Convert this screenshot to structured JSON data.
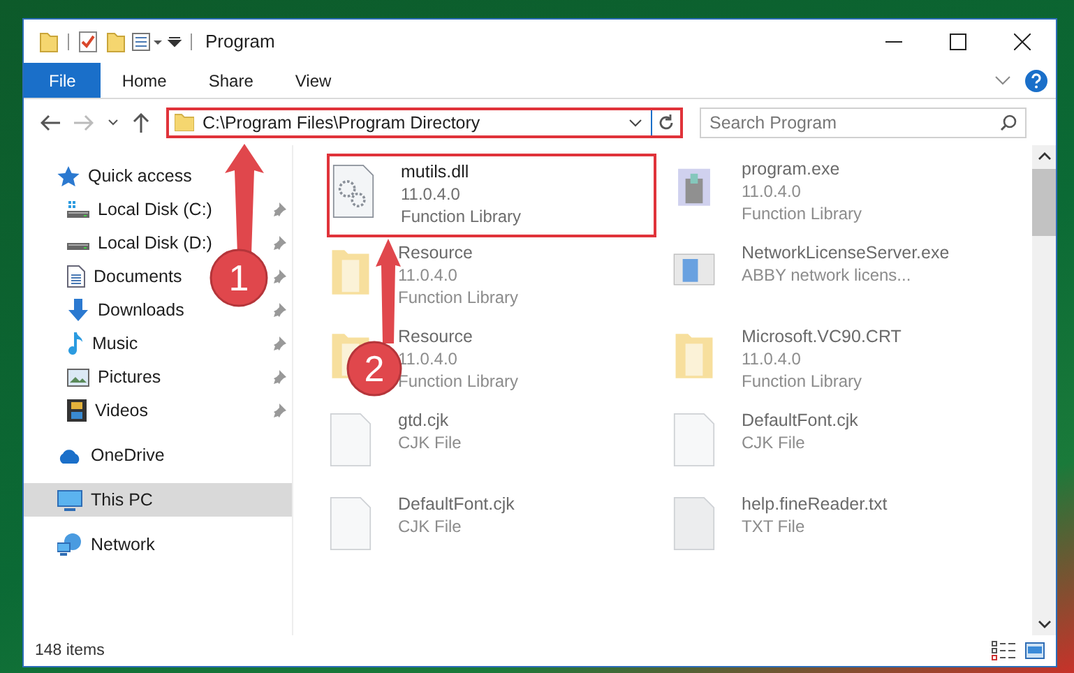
{
  "window": {
    "title": "Program"
  },
  "ribbon_tabs": [
    {
      "label": "File",
      "selected": true
    },
    {
      "label": "Home",
      "selected": false
    },
    {
      "label": "Share",
      "selected": false
    },
    {
      "label": "View",
      "selected": false
    }
  ],
  "address": {
    "value": "C:\\Program Files\\Program Directory",
    "highlighted": true
  },
  "search": {
    "placeholder": "Search Program"
  },
  "sidebar": [
    {
      "label": "Quick access",
      "kind": "star",
      "selected": false,
      "children": [
        {
          "label": "Local Disk (C:)",
          "kind": "drivec",
          "pinned": true
        },
        {
          "label": "Local Disk (D:)",
          "kind": "drive",
          "pinned": true
        },
        {
          "label": "Documents",
          "kind": "document",
          "pinned": true
        },
        {
          "label": "Downloads",
          "kind": "download",
          "pinned": true
        },
        {
          "label": "Music",
          "kind": "music",
          "pinned": true
        },
        {
          "label": "Pictures",
          "kind": "pictures",
          "pinned": true
        },
        {
          "label": "Videos",
          "kind": "videos",
          "pinned": true
        }
      ]
    },
    {
      "label": "OneDrive",
      "kind": "cloud",
      "selected": false
    },
    {
      "label": "This PC",
      "kind": "computer",
      "selected": true
    },
    {
      "label": "Network",
      "kind": "network",
      "selected": false
    }
  ],
  "files": [
    {
      "name": "mutils.dll",
      "version": "11.0.4.0",
      "type": "Function Library",
      "kind": "dll",
      "blurred": false,
      "highlighted": true
    },
    {
      "name": "program.exe",
      "version": "11.0.4.0",
      "type": "Function Library",
      "kind": "exe",
      "blurred": true,
      "highlighted": false
    },
    {
      "name": "Resource",
      "version": "11.0.4.0",
      "type": "Function Library",
      "kind": "folder",
      "blurred": true,
      "highlighted": false
    },
    {
      "name": "NetworkLicenseServer.exe",
      "type": "ABBY network licens...",
      "kind": "app",
      "blurred": true,
      "highlighted": false
    },
    {
      "name": "Resource",
      "version": "11.0.4.0",
      "type": "Function Library",
      "kind": "folder",
      "blurred": true,
      "highlighted": false
    },
    {
      "name": "Microsoft.VC90.CRT",
      "version": "11.0.4.0",
      "type": "Function Library",
      "kind": "folder",
      "blurred": true,
      "highlighted": false
    },
    {
      "name": "gtd.cjk",
      "type": "CJK File",
      "kind": "file",
      "blurred": true,
      "highlighted": false
    },
    {
      "name": "DefaultFont.cjk",
      "type": "CJK File",
      "kind": "file",
      "blurred": true,
      "highlighted": false
    },
    {
      "name": "DefaultFont.cjk",
      "type": "CJK File",
      "kind": "file",
      "blurred": true,
      "highlighted": false
    },
    {
      "name": "help.fineReader.txt",
      "type": "TXT File",
      "kind": "text",
      "blurred": true,
      "highlighted": false
    }
  ],
  "status_bar": {
    "count": "148 items"
  },
  "annotations": [
    {
      "number": "1"
    },
    {
      "number": "2"
    }
  ]
}
